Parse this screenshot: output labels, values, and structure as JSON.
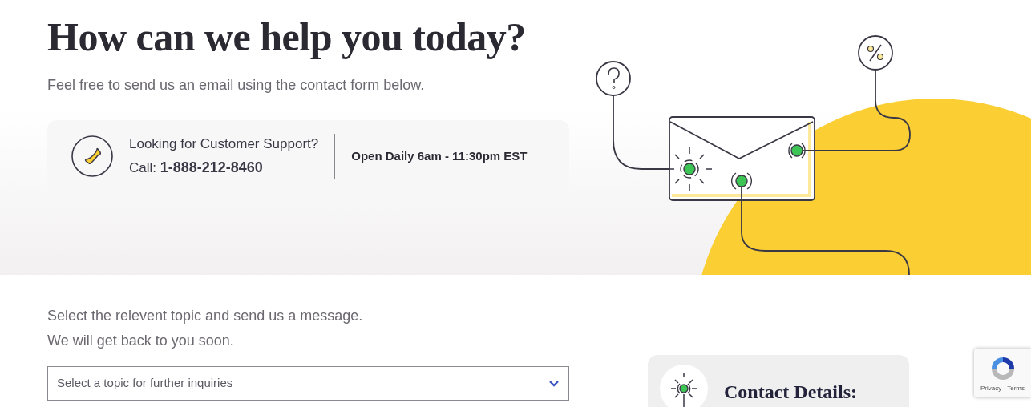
{
  "hero": {
    "title": "How can we help you today?",
    "subtitle": "Feel free to send us an email using the contact form below."
  },
  "support": {
    "question": "Looking for Customer Support?",
    "call": "Call: **1-888-212-8460**",
    "hours": "Open Daily 6am - 11:30pm EST"
  },
  "form": {
    "intro": [
      "Select the relevent topic and send us a message.",
      "We will get back to you soon."
    ],
    "topic_select": {
      "placeholder": "Select a topic for further inquiries"
    }
  },
  "contact_card": {
    "title": "Contact Details:"
  },
  "recaptcha": {
    "links": "Privacy - Terms"
  }
}
